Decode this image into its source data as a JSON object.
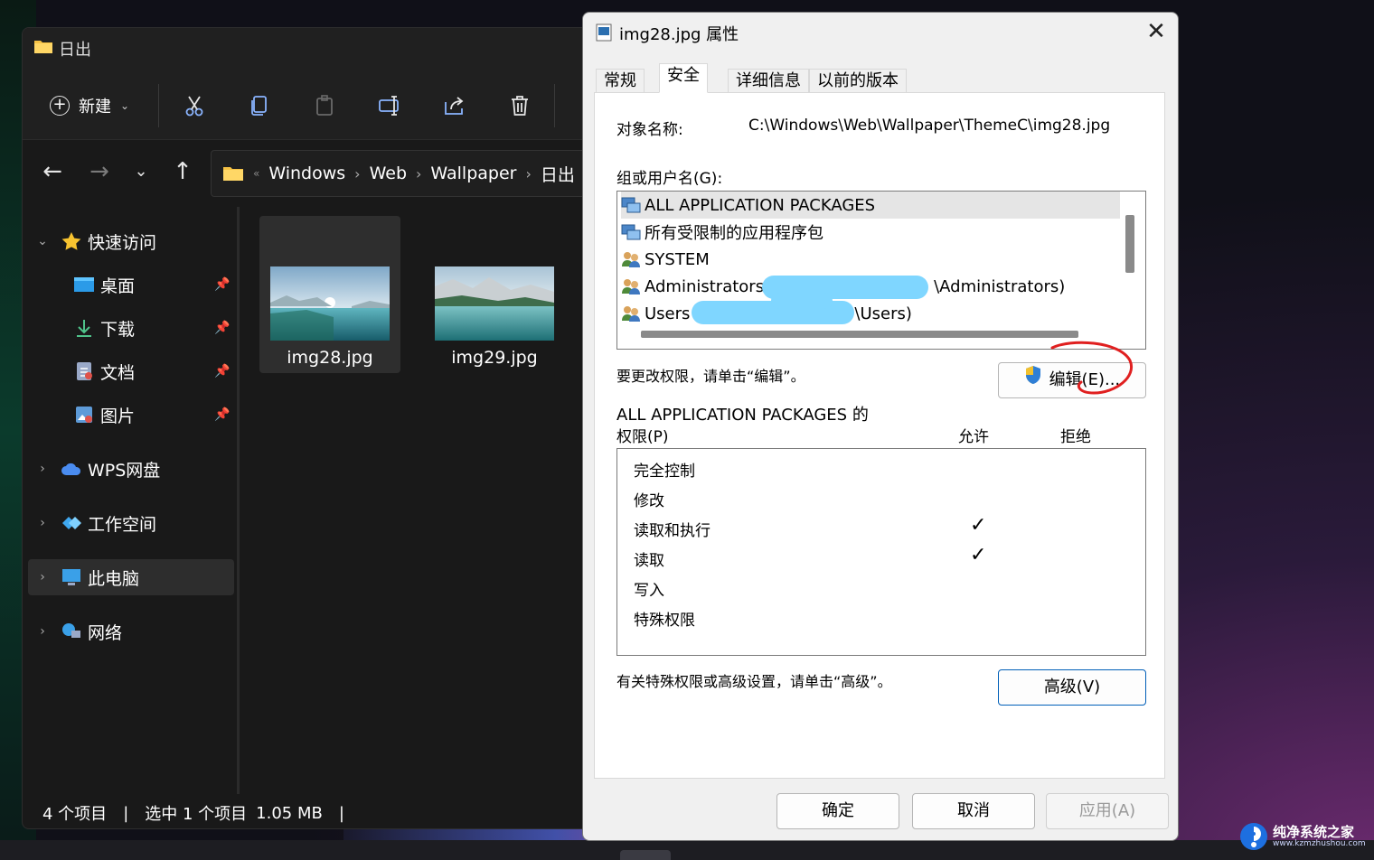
{
  "explorer": {
    "title": "日出",
    "toolbar": {
      "new_label": "新建",
      "icons": [
        "cut-icon",
        "copy-icon",
        "paste-icon",
        "rename-icon",
        "share-icon",
        "delete-icon"
      ]
    },
    "breadcrumb": [
      "Windows",
      "Web",
      "Wallpaper",
      "日出"
    ],
    "sidebar": {
      "quick_access": "快速访问",
      "items": [
        {
          "label": "桌面",
          "icon": "desktop-icon"
        },
        {
          "label": "下载",
          "icon": "download-icon"
        },
        {
          "label": "文档",
          "icon": "documents-icon"
        },
        {
          "label": "图片",
          "icon": "pictures-icon"
        }
      ],
      "wps": "WPS网盘",
      "workspace": "工作空间",
      "this_pc": "此电脑",
      "network": "网络"
    },
    "files": [
      {
        "name": "img28.jpg",
        "selected": true
      },
      {
        "name": "img29.jpg",
        "selected": false
      }
    ],
    "status": {
      "count": "4 个项目",
      "selection": "选中 1 个项目",
      "size": "1.05 MB"
    }
  },
  "dialog": {
    "title": "img28.jpg 属性",
    "tabs": [
      "常规",
      "安全",
      "详细信息",
      "以前的版本"
    ],
    "active_tab": "安全",
    "object_label": "对象名称:",
    "object_path": "C:\\Windows\\Web\\Wallpaper\\ThemeC\\img28.jpg",
    "group_label": "组或用户名(G):",
    "groups": [
      {
        "name": "ALL APPLICATION PACKAGES",
        "selected": true,
        "suffix": ""
      },
      {
        "name": "所有受限制的应用程序包",
        "selected": false,
        "suffix": ""
      },
      {
        "name": "SYSTEM",
        "selected": false,
        "suffix": ""
      },
      {
        "name": "Administrators",
        "selected": false,
        "suffix": "\\Administrators)"
      },
      {
        "name": "Users",
        "selected": false,
        "suffix": "\\Users)"
      }
    ],
    "edit_hint": "要更改权限，请单击“编辑”。",
    "edit_button": "编辑(E)...",
    "perm_title": "ALL APPLICATION PACKAGES 的",
    "perm_label": "权限(P)",
    "allow_label": "允许",
    "deny_label": "拒绝",
    "permissions": [
      {
        "name": "完全控制",
        "allow": false,
        "deny": false
      },
      {
        "name": "修改",
        "allow": false,
        "deny": false
      },
      {
        "name": "读取和执行",
        "allow": true,
        "deny": false
      },
      {
        "name": "读取",
        "allow": true,
        "deny": false
      },
      {
        "name": "写入",
        "allow": false,
        "deny": false
      },
      {
        "name": "特殊权限",
        "allow": false,
        "deny": false
      }
    ],
    "advanced_hint": "有关特殊权限或高级设置，请单击“高级”。",
    "advanced_button": "高级(V)",
    "ok_button": "确定",
    "cancel_button": "取消",
    "apply_button": "应用(A)"
  },
  "watermark": {
    "text": "纯净系统之家",
    "url": "www.kzmzhushou.com"
  }
}
